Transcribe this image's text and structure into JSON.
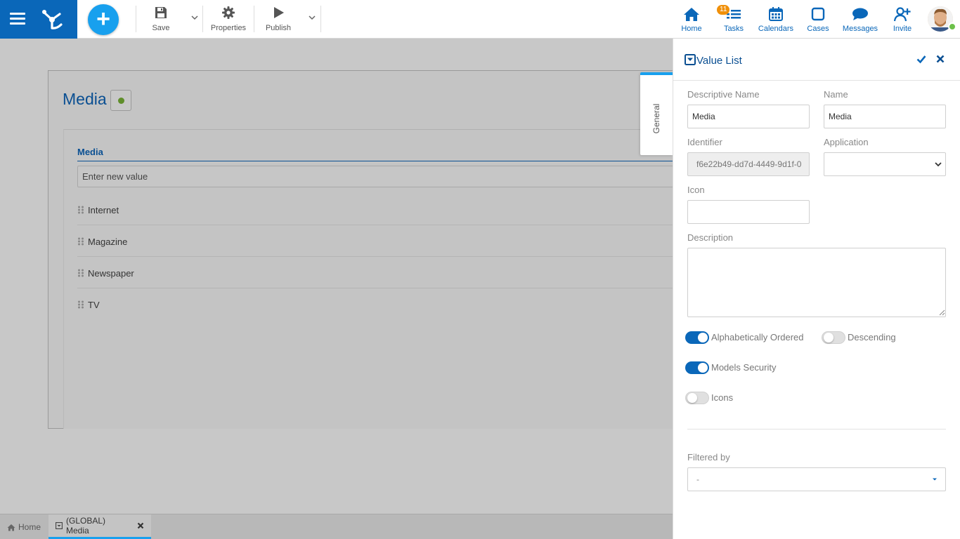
{
  "toolbar": {
    "save_label": "Save",
    "properties_label": "Properties",
    "publish_label": "Publish"
  },
  "nav": {
    "home": "Home",
    "tasks": "Tasks",
    "tasks_badge": "11",
    "calendars": "Calendars",
    "cases": "Cases",
    "messages": "Messages",
    "invite": "Invite"
  },
  "form": {
    "title": "Media",
    "list_label": "Media",
    "new_value_placeholder": "Enter new value",
    "items": [
      "Internet",
      "Magazine",
      "Newspaper",
      "TV"
    ],
    "side_tab": "General"
  },
  "bottom_tabs": {
    "home": "Home",
    "active": "(GLOBAL) Media"
  },
  "panel": {
    "title": "Value List",
    "descriptive_name_label": "Descriptive Name",
    "descriptive_name_value": "Media",
    "name_label": "Name",
    "name_value": "Media",
    "identifier_label": "Identifier",
    "identifier_value": "f6e22b49-dd7d-4449-9d1f-0",
    "application_label": "Application",
    "application_value": "",
    "icon_label": "Icon",
    "icon_value": "",
    "description_label": "Description",
    "description_value": "",
    "alpha_ordered_label": "Alphabetically Ordered",
    "alpha_ordered_on": true,
    "descending_label": "Descending",
    "descending_on": false,
    "models_security_label": "Models Security",
    "models_security_on": true,
    "icons_label": "Icons",
    "icons_on": false,
    "filtered_by_label": "Filtered by",
    "filtered_by_value": "-"
  },
  "colors": {
    "brand": "#0a67b9",
    "accent": "#18a0ee",
    "badge": "#f0900a",
    "title": "#0a4f92"
  }
}
